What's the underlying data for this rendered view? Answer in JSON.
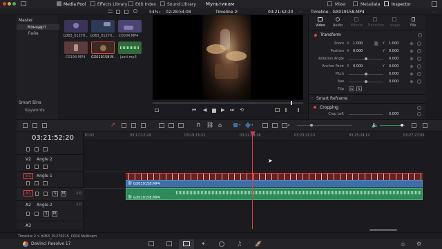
{
  "topbar": {
    "media_pool": "Media Pool",
    "effects_library": "Effects Library",
    "edit_index": "Edit Index",
    "sound_library": "Sound Library",
    "project_title": "Мультикам",
    "mixer": "Mixer",
    "metadata": "Metadata",
    "inspector": "Inspector"
  },
  "subbar": {
    "zoom": "54%",
    "source_timecode": "02:28:54:08",
    "timeline_name": "Timeline 2",
    "record_timecode": "03:21:52:20",
    "inspector_title": "Timeline - GX019158.MP4"
  },
  "media_pool": {
    "bins": [
      "Master",
      "Концерт",
      "Лайв"
    ],
    "smart_bins_title": "Smart Bins",
    "smart_bins": [
      "Keywords"
    ],
    "clips": [
      {
        "name": "b063_01270...",
        "color": "#3a3558"
      },
      {
        "name": "b063_01270...",
        "color": "#2d3a55"
      },
      {
        "name": "C0004.MP4",
        "color": "#4a4470"
      },
      {
        "name": "C0194.MP4",
        "color": "#5a3a3a"
      },
      {
        "name": "GX019158.M...",
        "color": "#3b2a22"
      },
      {
        "name": "Jaeti.mp3",
        "color": "#2f6a3a"
      }
    ]
  },
  "inspector": {
    "tabs": [
      "Video",
      "Audio",
      "Effects",
      "Transition",
      "Image",
      "File"
    ],
    "transform_title": "Transform",
    "zoom_label": "Zoom",
    "zoom_x": "1.000",
    "zoom_y": "1.000",
    "position_label": "Position",
    "position_x": "0.000",
    "position_y": "0.000",
    "rotation_label": "Rotation Angle",
    "rotation_value": "0.000",
    "anchor_label": "Anchor Point",
    "anchor_x": "0.000",
    "anchor_y": "0.000",
    "pitch_label": "Pitch",
    "pitch_value": "0.000",
    "yaw_label": "Yaw",
    "yaw_value": "0.000",
    "flip_label": "Flip",
    "smart_reframe": "Smart Reframe",
    "cropping_title": "Cropping",
    "crop_left_label": "Crop Left",
    "crop_left_value": "0.000"
  },
  "timeline": {
    "timecode": "03:21:52:20",
    "ruler_start": "10:02",
    "ruler_labels": [
      "03:17:12:24",
      "03:19:15:21",
      "03:21:18:18",
      "03:23:21:15",
      "03:25:24:12",
      "03:27:27:09"
    ],
    "tracks": [
      {
        "id": "V2",
        "name": "Angle 2"
      },
      {
        "id": "V1",
        "name": "Angle 1"
      },
      {
        "id": "A1",
        "name": "",
        "channels": "2.0"
      },
      {
        "id": "A2",
        "name": "Angle 2",
        "channels": "2.0"
      },
      {
        "id": "A3",
        "name": ""
      }
    ],
    "a1_buttons": [
      "S",
      "M"
    ],
    "clips": [
      {
        "label": "GX019158.MP4",
        "kind": "video"
      },
      {
        "label": "GX019158.MP4",
        "kind": "audio"
      }
    ]
  },
  "statusbar": {
    "breadcrumb": "Timeline 2 > b063_01270215_C004 Multicam",
    "app_name": "DaVinci Resolve 17"
  },
  "colors": {
    "accent_red": "#e0403a",
    "video_clip": "#3d6ea8",
    "audio_clip": "#2f8a5a",
    "playhead": "#e0403a"
  }
}
